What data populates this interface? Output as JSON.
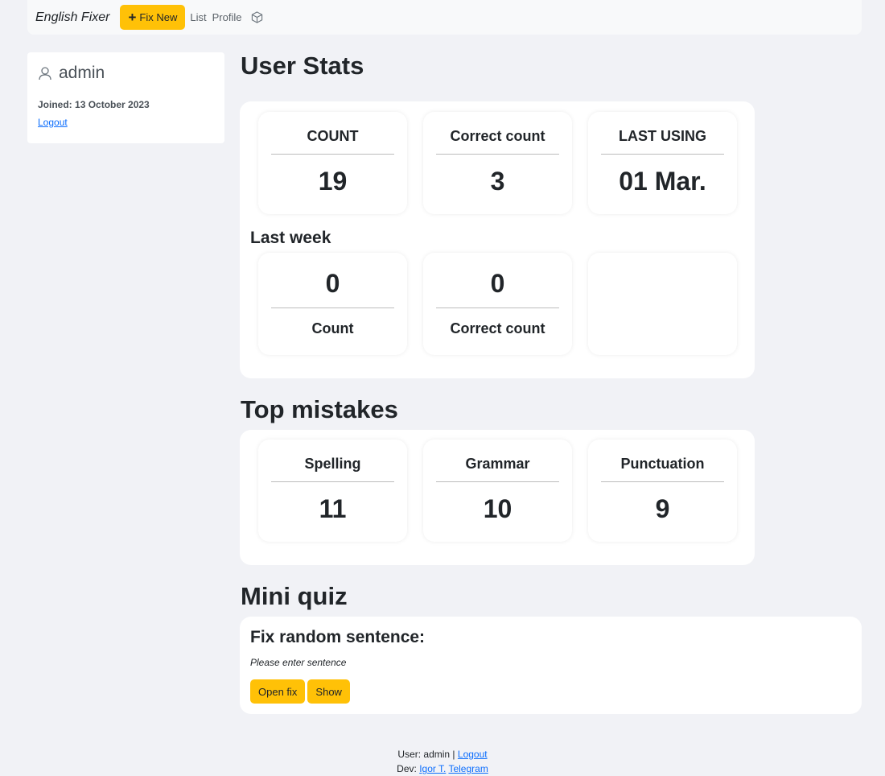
{
  "navbar": {
    "brand": "English Fixer",
    "fix_new_label": "Fix New",
    "links": [
      "List",
      "Profile"
    ]
  },
  "profile": {
    "username": "admin",
    "joined_label": "Joined:",
    "joined_date": "13 October 2023",
    "logout_label": "Logout"
  },
  "user_stats": {
    "title": "User Stats",
    "top": [
      {
        "label": "COUNT",
        "value": "19"
      },
      {
        "label": "Correct count",
        "value": "3"
      },
      {
        "label": "LAST USING",
        "value": "01 Mar."
      }
    ],
    "last_week_title": "Last week",
    "last_week": [
      {
        "label": "Count",
        "value": "0"
      },
      {
        "label": "Correct count",
        "value": "0"
      }
    ]
  },
  "top_mistakes": {
    "title": "Top mistakes",
    "items": [
      {
        "label": "Spelling",
        "value": "11"
      },
      {
        "label": "Grammar",
        "value": "10"
      },
      {
        "label": "Punctuation",
        "value": "9"
      }
    ]
  },
  "mini_quiz": {
    "title": "Mini quiz",
    "subtitle": "Fix random sentence:",
    "sentence": "Please enter sentence",
    "open_fix_label": "Open fix",
    "show_label": "Show"
  },
  "footer": {
    "user_prefix": "User: admin |",
    "logout_label": "Logout",
    "dev_prefix": "Dev:",
    "dev_name": "Igor T.",
    "telegram_label": "Telegram"
  },
  "colors": {
    "accent": "#ffc107",
    "link": "#0d6efd",
    "background": "#f1f2f6"
  },
  "icons": [
    "plus-icon",
    "cube-icon",
    "user-icon"
  ]
}
